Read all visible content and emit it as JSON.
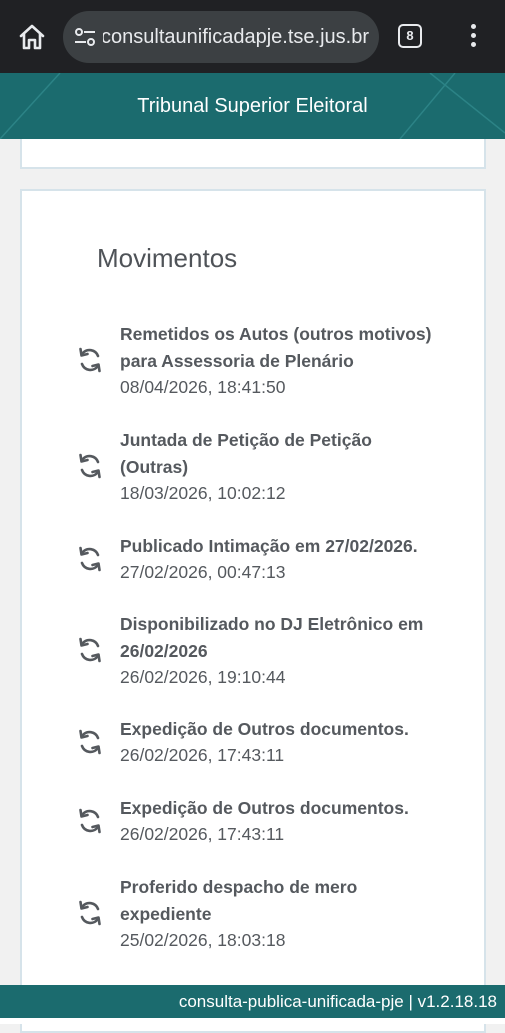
{
  "browser": {
    "url": "consultaunificadapje.tse.jus.br",
    "tab_count": "8"
  },
  "header": {
    "title": "Tribunal Superior Eleitoral"
  },
  "movimentos": {
    "title": "Movimentos",
    "items": [
      {
        "desc_l1": "Remetidos os Autos (outros motivos)",
        "desc_l2": "para Assessoria de Plenário",
        "date": "08/04/2026, 18:41:50"
      },
      {
        "desc_l1": "Juntada de Petição de Petição",
        "desc_l2": "(Outras)",
        "date": "18/03/2026, 10:02:12"
      },
      {
        "desc_l1": "Publicado Intimação em 27/02/2026.",
        "desc_l2": "",
        "date": "27/02/2026, 00:47:13"
      },
      {
        "desc_l1": "Disponibilizado no DJ Eletrônico em",
        "desc_l2": "26/02/2026",
        "date": "26/02/2026, 19:10:44"
      },
      {
        "desc_l1": "Expedição de Outros documentos.",
        "desc_l2": "",
        "date": "26/02/2026, 17:43:11"
      },
      {
        "desc_l1": "Expedição de Outros documentos.",
        "desc_l2": "",
        "date": "26/02/2026, 17:43:11"
      },
      {
        "desc_l1": "Proferido despacho de mero",
        "desc_l2": "expediente",
        "date": "25/02/2026, 18:03:18"
      }
    ]
  },
  "footer": {
    "text": "consulta-publica-unificada-pje | v1.2.18.18"
  },
  "colors": {
    "header_bg": "#1b6b6e",
    "chrome_bg": "#202124",
    "card_border": "#d6e3ea",
    "text": "#55595e"
  }
}
